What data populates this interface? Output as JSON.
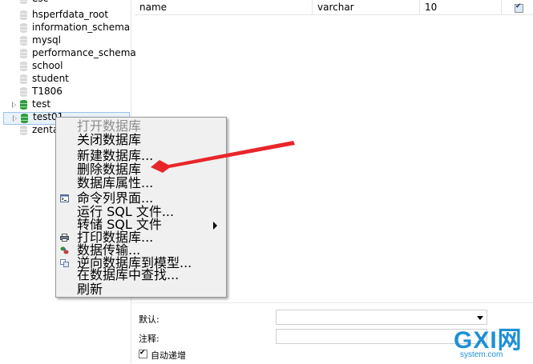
{
  "sidebar": {
    "items": [
      {
        "label": "esc",
        "expandable": false,
        "open": false
      },
      {
        "label": "hsperfdata_root",
        "expandable": false,
        "open": false
      },
      {
        "label": "information_schema",
        "expandable": false,
        "open": false
      },
      {
        "label": "mysql",
        "expandable": false,
        "open": false
      },
      {
        "label": "performance_schema",
        "expandable": false,
        "open": false
      },
      {
        "label": "school",
        "expandable": false,
        "open": false
      },
      {
        "label": "student",
        "expandable": false,
        "open": false
      },
      {
        "label": "T1806",
        "expandable": false,
        "open": false
      },
      {
        "label": "test",
        "expandable": true,
        "open": true
      },
      {
        "label": "test01",
        "expandable": true,
        "open": true,
        "selected": true
      },
      {
        "label": "zentao",
        "expandable": false,
        "open": false
      }
    ]
  },
  "fields_grid": {
    "row": {
      "name": "name",
      "type": "varchar",
      "length": "10",
      "checked": true
    }
  },
  "context_menu": {
    "items": [
      {
        "label": "打开数据库",
        "disabled": true,
        "icon": ""
      },
      {
        "label": "关闭数据库",
        "disabled": false,
        "icon": ""
      },
      {
        "label": "新建数据库...",
        "disabled": false,
        "icon": ""
      },
      {
        "label": "删除数据库",
        "disabled": false,
        "icon": ""
      },
      {
        "label": "数据库属性...",
        "disabled": false,
        "icon": ""
      },
      {
        "label": "命令列界面...",
        "disabled": false,
        "icon": "console-icon"
      },
      {
        "label": "运行 SQL 文件...",
        "disabled": false,
        "icon": ""
      },
      {
        "label": "转储 SQL 文件",
        "disabled": false,
        "icon": "",
        "submenu": true
      },
      {
        "label": "打印数据库...",
        "disabled": false,
        "icon": "printer-icon"
      },
      {
        "label": "数据传输...",
        "disabled": false,
        "icon": "data-transfer-icon"
      },
      {
        "label": "逆向数据库到模型...",
        "disabled": false,
        "icon": "reverse-model-icon"
      },
      {
        "label": "在数据库中查找...",
        "disabled": false,
        "icon": ""
      },
      {
        "label": "刷新",
        "disabled": false,
        "icon": ""
      }
    ]
  },
  "properties": {
    "default_label": "默认:",
    "default_value": "",
    "comment_label": "注释:",
    "comment_value": "",
    "auto_increment_label": "自动递增",
    "auto_increment_checked": true
  },
  "watermark": {
    "main": "GXI网",
    "sub": "system.com"
  },
  "colors": {
    "annotation_arrow": "#e8262a",
    "db_open": "#2f9d3c",
    "db_closed": "#d9d9d9",
    "selection_bg": "#e9f1fb",
    "watermark": "#1f8fd6"
  }
}
